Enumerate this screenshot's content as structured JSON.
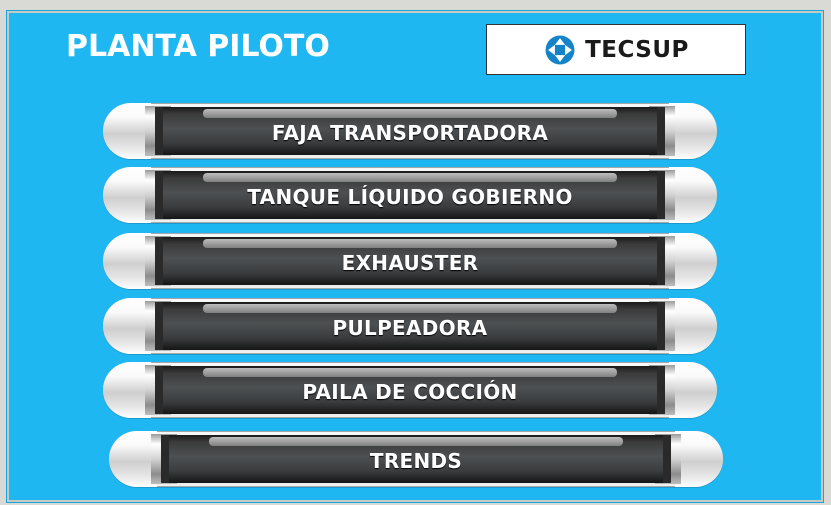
{
  "header": {
    "title": "PLANTA PILOTO",
    "logo_text": "TECSUP"
  },
  "menu": {
    "items": [
      {
        "label": "FAJA TRANSPORTADORA"
      },
      {
        "label": "TANQUE LÍQUIDO GOBIERNO"
      },
      {
        "label": "EXHAUSTER"
      },
      {
        "label": "PULPEADORA"
      },
      {
        "label": "PAILA DE COCCIÓN"
      },
      {
        "label": "TRENDS"
      }
    ]
  },
  "colors": {
    "background": "#1fb7f2",
    "button_core": "#3b3b3b",
    "button_text": "#ffffff",
    "logo_mark": "#1583c8"
  },
  "icons": {
    "logo": "tecsup-logo-mark"
  }
}
